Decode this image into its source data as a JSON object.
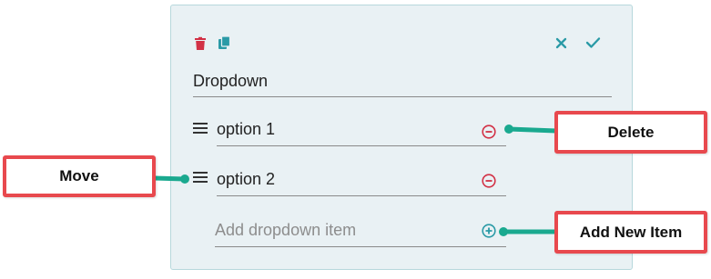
{
  "card": {
    "title_value": "Dropdown",
    "options": [
      {
        "label": "option 1"
      },
      {
        "label": "option 2"
      }
    ],
    "add_item_placeholder": "Add dropdown item"
  },
  "callouts": {
    "delete": "Delete",
    "move": "Move",
    "add_new_item": "Add New Item"
  },
  "icons": {
    "delete_card": "trash-icon",
    "copy_card": "copy-icon",
    "cancel": "close-icon",
    "confirm": "check-icon",
    "drag": "drag-handle-icon",
    "remove_option": "minus-circle-icon",
    "add_option": "plus-circle-icon"
  },
  "colors": {
    "card_background": "#e9f1f4",
    "danger": "#d23145",
    "accent": "#2a9aa6",
    "callout_border": "#e8494e",
    "connector": "#1aa98f"
  }
}
